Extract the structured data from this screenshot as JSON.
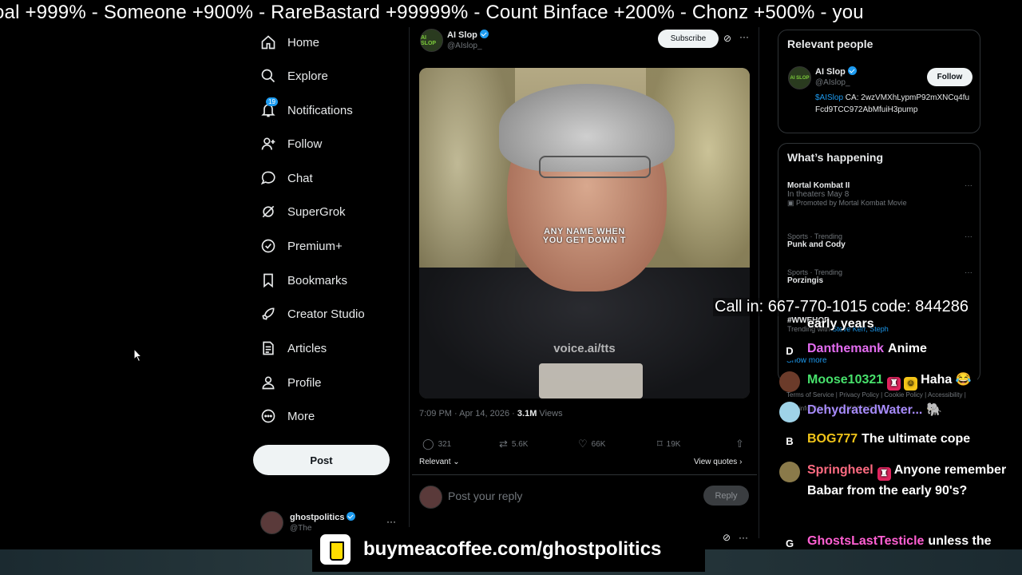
{
  "ticker": "oal +999%  -  Someone +900% - RareBastard +99999% - Count Binface +200%  - Chonz +500%   -   you",
  "nav": {
    "items": [
      {
        "label": "Home",
        "icon": "home-icon"
      },
      {
        "label": "Explore",
        "icon": "search-icon"
      },
      {
        "label": "Notifications",
        "icon": "bell-icon",
        "badge": "19"
      },
      {
        "label": "Follow",
        "icon": "person-add-icon"
      },
      {
        "label": "Chat",
        "icon": "chat-icon"
      },
      {
        "label": "SuperGrok",
        "icon": "grok-icon"
      },
      {
        "label": "Premium+",
        "icon": "premium-icon"
      },
      {
        "label": "Bookmarks",
        "icon": "bookmark-icon"
      },
      {
        "label": "Creator Studio",
        "icon": "rocket-icon"
      },
      {
        "label": "Articles",
        "icon": "article-icon"
      },
      {
        "label": "Profile",
        "icon": "person-icon"
      },
      {
        "label": "More",
        "icon": "more-circle-icon"
      }
    ],
    "post_label": "Post",
    "account": {
      "name": "ghostpolitics",
      "handle": "@The"
    }
  },
  "tweet": {
    "author_name": "AI Slop",
    "author_handle": "@AIslop_",
    "avatar_text": "AI SLOP",
    "subscribe_label": "Subscribe",
    "caption_line1": "ANY NAME WHEN",
    "caption_line2": "YOU GET DOWN T",
    "watermark": "voice.ai/tts",
    "timestamp": "7:09 PM · Apr 14, 2026 · ",
    "views_count": "3.1M",
    "views_label": " Views",
    "replies": "321",
    "reposts": "5.6K",
    "likes": "66K",
    "bookmarks": "19K",
    "sort_label": "Relevant",
    "view_quotes": "View quotes",
    "reply_placeholder": "Post your reply",
    "reply_button": "Reply"
  },
  "sidebar": {
    "relevant_title": "Relevant people",
    "person": {
      "name": "AI Slop",
      "handle": "@AIslop_",
      "avatar_text": "AI SLOP",
      "follow_label": "Follow",
      "bio_cashtag": "$AISlop",
      "bio_rest": " CA: 2wzVMXhLypmP92mXNCq4fuFcd9TCC972AbMfuiH3pump"
    },
    "happening_title": "What’s happening",
    "trends": [
      {
        "title": "Mortal Kombat II",
        "sub": "In theaters May 8",
        "promo": "Promoted by Mortal Kombat Movie"
      },
      {
        "top": "Sports · Trending",
        "title": "Punk and Cody"
      },
      {
        "top": "Sports · Trending",
        "title": "Porzingis"
      },
      {
        "title": "#WWEHOF",
        "with_label": "Trending with ",
        "with_names": "Steve Kerr, Steph"
      }
    ],
    "show_more": "Show more",
    "footer": "Terms of Service  |  Privacy Policy  |  Cookie Policy  |  Accessibility  |  Ads info  |  More ···  © 2026 X Corp."
  },
  "callin": "Call in: 667-770-1015 code: 844286",
  "chat": [
    {
      "avatar": "",
      "user": "",
      "text": "early years",
      "user_color": "#ffffff"
    },
    {
      "avatar": "D",
      "user": "Danthemank",
      "text": "Anime",
      "user_color": "#e36cf0"
    },
    {
      "avatar": "",
      "user": "Moose10321",
      "text": "Haha 😂",
      "user_color": "#47e06b"
    },
    {
      "avatar": "",
      "user": "DehydratedWater...",
      "text": "🐘",
      "user_color": "#a78bfa"
    },
    {
      "avatar": "B",
      "user": "BOG777",
      "text": "The ultimate cope",
      "user_color": "#f0c419"
    },
    {
      "avatar": "",
      "user": "Springheel",
      "text": "Anyone remember Babar from the early 90's?",
      "user_color": "#ff6b81"
    },
    {
      "avatar": "G",
      "user": "GhostsLastTesticle",
      "text": "unless the mommy elephant stomps it",
      "user_color": "#ff5fd2"
    }
  ],
  "coffee": "buymeacoffee.com/ghostpolitics",
  "colors": {
    "accent": "#1d9bf0",
    "bg": "#000000"
  }
}
